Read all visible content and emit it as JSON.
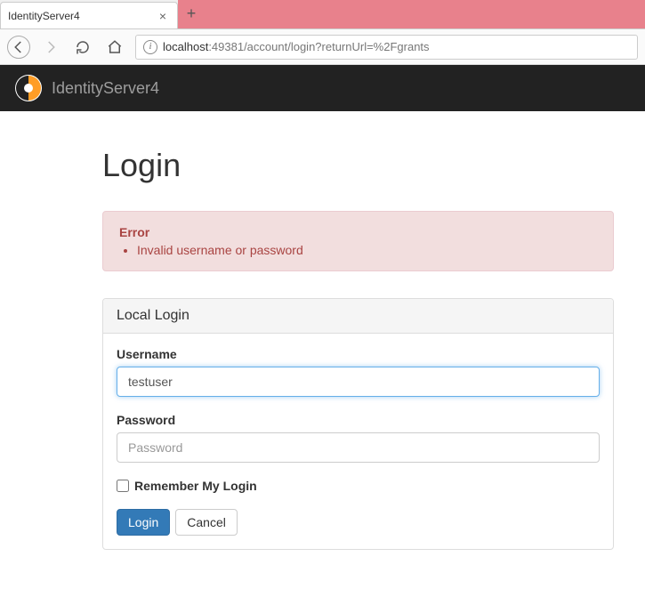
{
  "browser": {
    "tab_title": "IdentityServer4",
    "url_host": "localhost",
    "url_path": ":49381/account/login?returnUrl=%2Fgrants"
  },
  "header": {
    "brand": "IdentityServer4"
  },
  "page": {
    "title": "Login"
  },
  "alert": {
    "title": "Error",
    "message": "Invalid username or password"
  },
  "panel": {
    "heading": "Local Login"
  },
  "form": {
    "username_label": "Username",
    "username_value": "testuser",
    "password_label": "Password",
    "password_placeholder": "Password",
    "remember_label": "Remember My Login",
    "login_button": "Login",
    "cancel_button": "Cancel"
  }
}
